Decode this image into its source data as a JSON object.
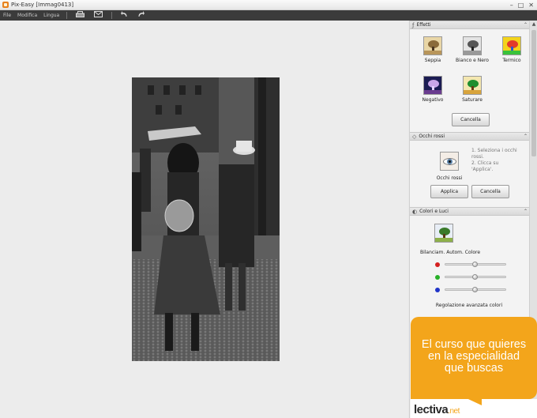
{
  "window": {
    "title": "Pix-Easy [Immag0413]",
    "minimize": "–",
    "maximize": "□",
    "close": "✕"
  },
  "menu": {
    "items": [
      "File",
      "Modifica",
      "Lingua"
    ],
    "toolbar_icons": [
      "print-icon",
      "email-icon",
      "undo-icon",
      "redo-icon"
    ]
  },
  "panel": {
    "effetti": {
      "title": "Effetti",
      "items": [
        {
          "label": "Seppia",
          "icon": "sepia-tree-icon"
        },
        {
          "label": "Bianco e Nero",
          "icon": "bw-tree-icon"
        },
        {
          "label": "Termico",
          "icon": "thermal-tree-icon"
        },
        {
          "label": "Negativo",
          "icon": "negative-tree-icon"
        },
        {
          "label": "Saturare",
          "icon": "saturate-tree-icon"
        }
      ],
      "cancel": "Cancella"
    },
    "occhi_rossi": {
      "title": "Occhi rossi",
      "thumb_label": "Occhi rossi",
      "instructions": [
        "1. Seleziona i occhi",
        "rossi.",
        "2. Clicca su",
        "'Applica'."
      ],
      "apply": "Applica",
      "cancel": "Cancella"
    },
    "colori_luci": {
      "title": "Colori e Luci",
      "thumb_label": "Bilanciam. Autom. Colore",
      "sliders": [
        {
          "channel": "red",
          "color": "#d42020",
          "value": 0.5
        },
        {
          "channel": "green",
          "color": "#28b028",
          "value": 0.5
        },
        {
          "channel": "blue",
          "color": "#2034c8",
          "value": 0.5
        }
      ],
      "advanced_label": "Regolazione avanzata colori"
    }
  },
  "ad": {
    "text_lines": [
      "El curso que quieres",
      "en la especialidad",
      "que buscas"
    ],
    "logo_main": "lectiva",
    "logo_suffix": ".net"
  },
  "colors": {
    "menubar": "#3b3b3b",
    "ad_orange": "#f3a51b"
  }
}
